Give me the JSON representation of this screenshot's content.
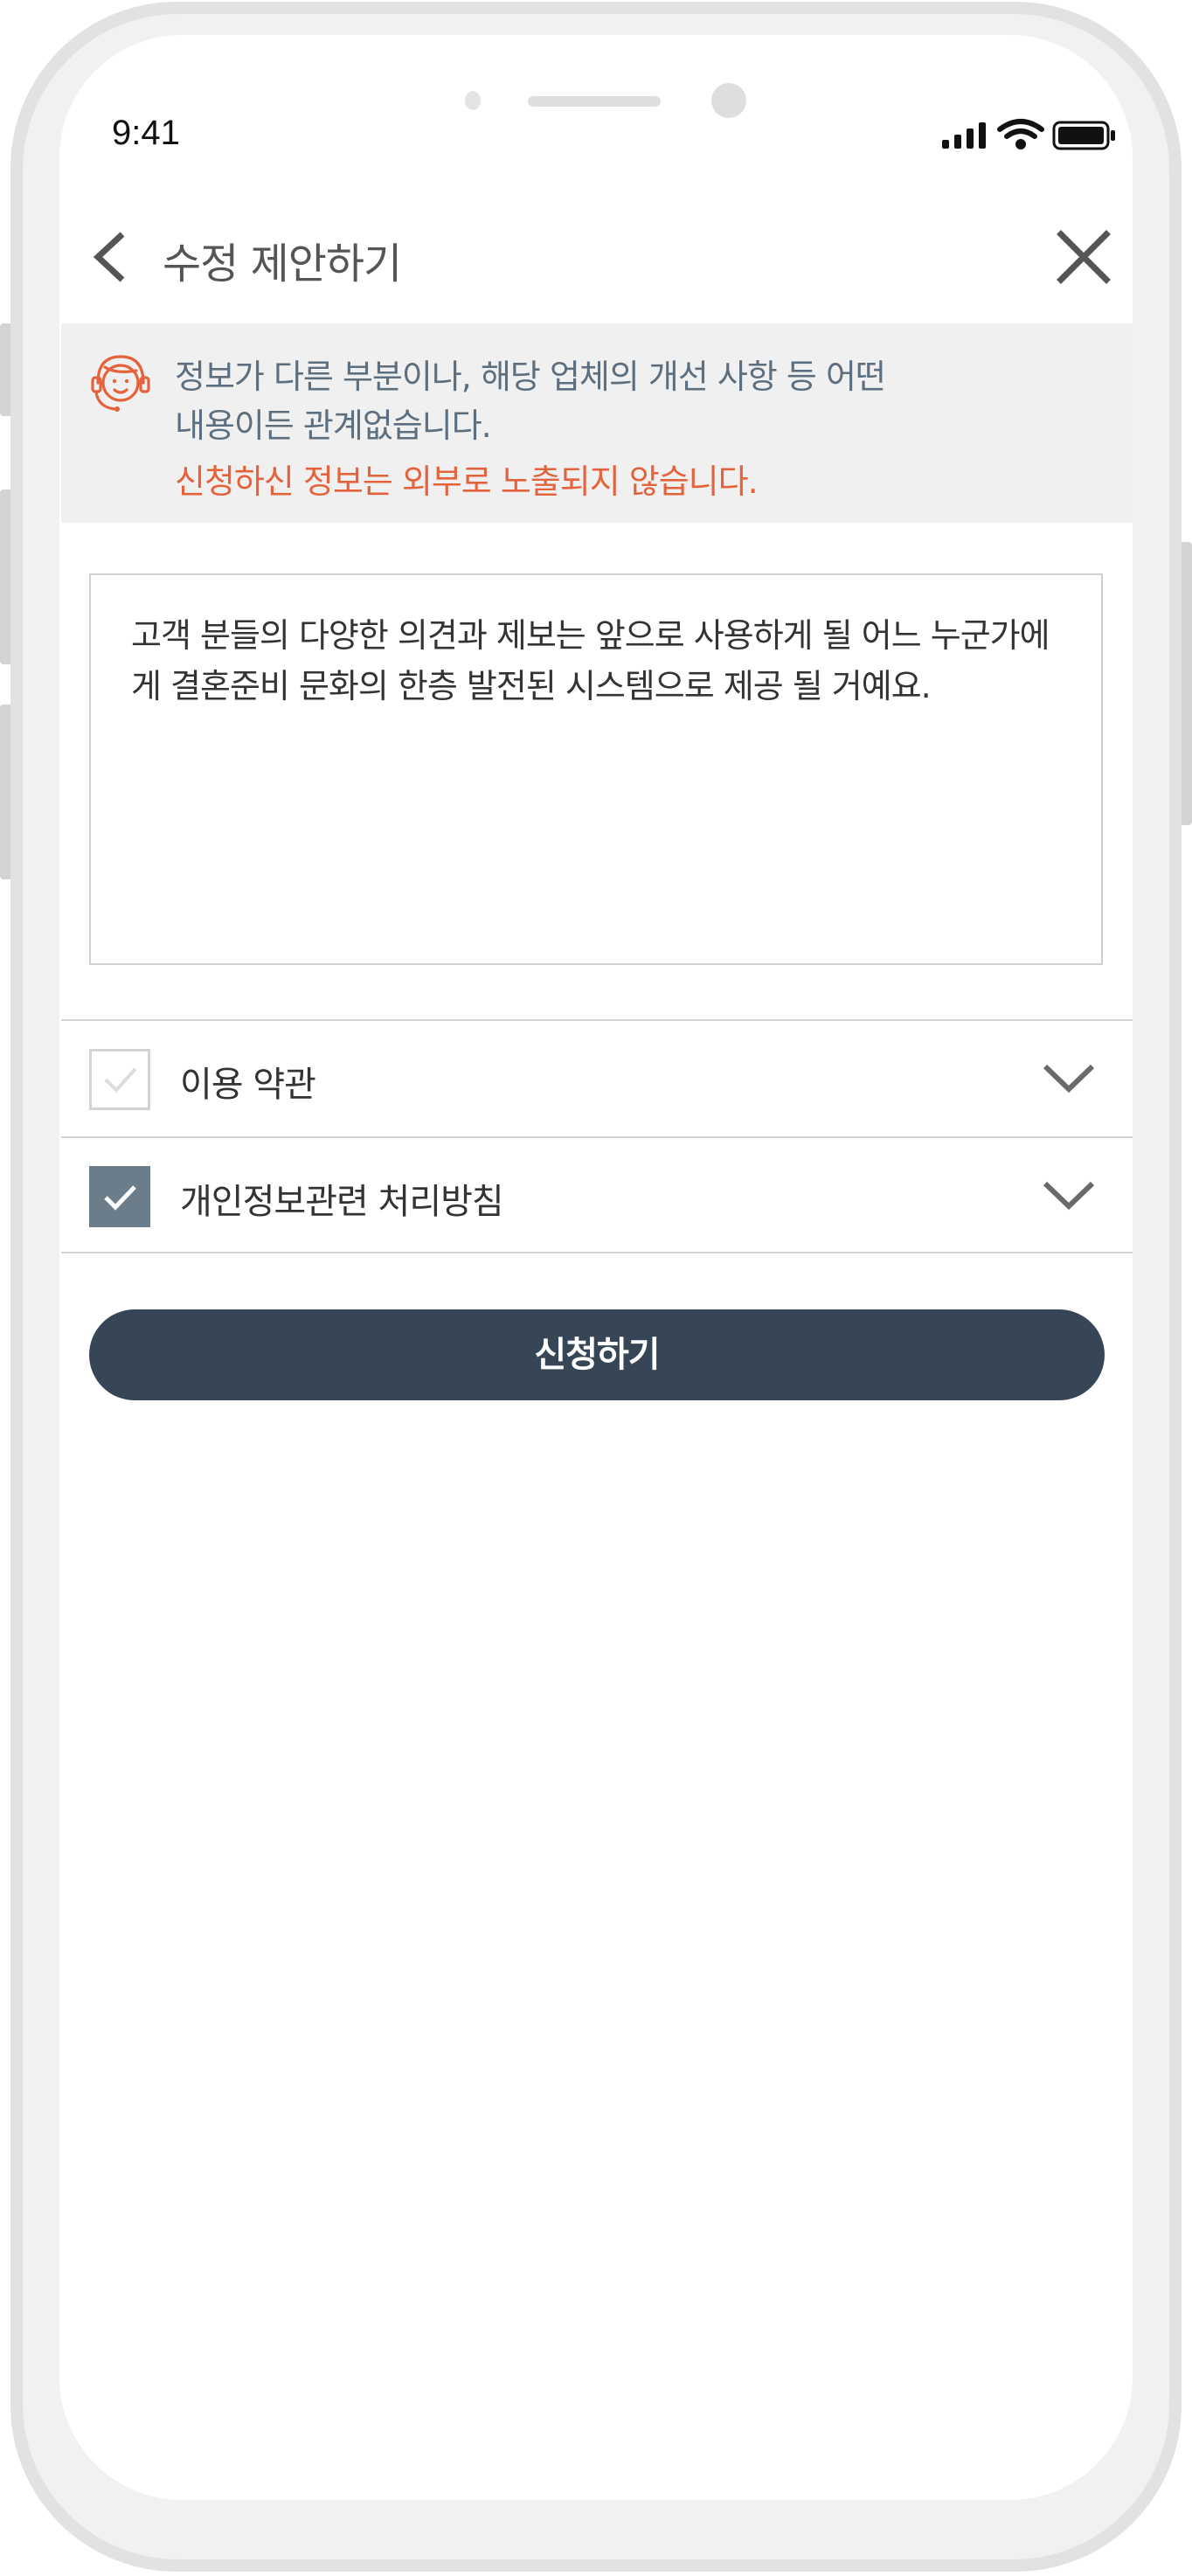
{
  "status_bar": {
    "time": "9:41",
    "icons": [
      "signal-icon",
      "wifi-icon",
      "battery-icon"
    ]
  },
  "header": {
    "title": "수정 제안하기",
    "back_icon": "chevron-left-icon",
    "close_icon": "close-icon"
  },
  "notice": {
    "icon": "headset-agent-icon",
    "line1": "정보가 다른 부분이나, 해당 업체의 개선 사항 등 어떤",
    "line2": "내용이든 관계없습니다.",
    "line3": "신청하신 정보는 외부로 노출되지 않습니다.",
    "accent_color": "#e4633c"
  },
  "memo": {
    "text": "고객 분들의 다양한 의견과 제보는 앞으로 사용하게 될 어느 누군가에게 결혼준비 문화의 한층 발전된 시스템으로 제공 될 거예요."
  },
  "agreements": [
    {
      "label": "이용 약관",
      "checked": false
    },
    {
      "label": "개인정보관련 처리방침",
      "checked": true
    }
  ],
  "submit": {
    "label": "신청하기",
    "color": "#374656"
  }
}
